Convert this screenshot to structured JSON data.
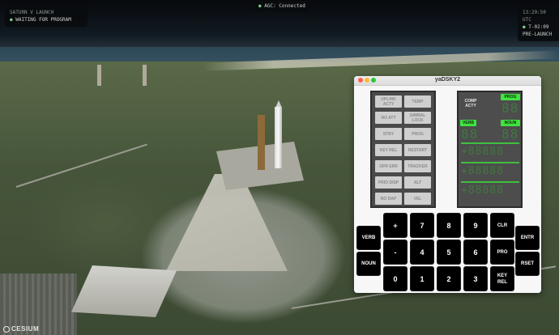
{
  "hud": {
    "left": {
      "title": "SATURN V LAUNCH",
      "status": "WAITING FOR PROGRAM",
      "status_icon": "status-dot"
    },
    "center": {
      "text": "AGC: Connected",
      "icon": "link-dot"
    },
    "right": {
      "clock": "13:29:50 UTC",
      "countdown": "T-02:09",
      "phase": "PRE-LAUNCH"
    }
  },
  "window": {
    "title": "yaDSKY2"
  },
  "indicators": [
    [
      "UPLINK ACTY",
      "TEMP"
    ],
    [
      "NO ATT",
      "GIMBAL LOCK"
    ],
    [
      "STBY",
      "PROG"
    ],
    [
      "KEY REL",
      "RESTART"
    ],
    [
      "OPR ERR",
      "TRACKER"
    ],
    [
      "PRIO DISP",
      "ALT"
    ],
    [
      "NO DAP",
      "VEL"
    ]
  ],
  "el_display": {
    "comp_acty": "COMP ACTY",
    "prog_label": "PROG",
    "verb_label": "VERB",
    "noun_label": "NOUN",
    "prog_value": "88",
    "verb_value": "88",
    "noun_value": "88",
    "r1": "+88888",
    "r2": "+88888",
    "r3": "+88888"
  },
  "keypad": {
    "verb": "VERB",
    "noun": "NOUN",
    "row1": [
      "+",
      "7",
      "8",
      "9",
      "CLR"
    ],
    "row2": [
      "-",
      "4",
      "5",
      "6",
      "PRO"
    ],
    "row3": [
      "0",
      "1",
      "2",
      "3",
      "KEY REL"
    ],
    "entr": "ENTR",
    "rset": "RSET"
  },
  "credit": {
    "text": "CESIUM"
  },
  "colors": {
    "el_green": "#3fe33f",
    "indicator_off": "#cfcfcf",
    "hud_accent": "#7fd08a"
  }
}
